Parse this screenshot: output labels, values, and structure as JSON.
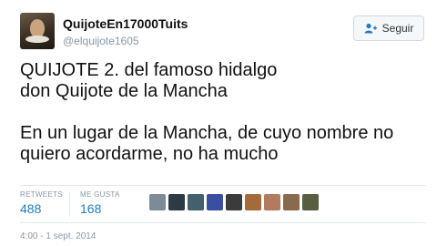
{
  "user": {
    "display_name": "QuijoteEn17000Tuits",
    "handle": "@elquijote1605"
  },
  "follow_button": {
    "label": "Seguir",
    "icon": "add-user-icon"
  },
  "tweet": {
    "lines_para1": [
      "QUIJOTE 2. del famoso hidalgo",
      "don Quijote de la Mancha"
    ],
    "lines_para2": [
      "En un lugar de la Mancha, de cuyo nombre no",
      "quiero acordarme, no ha mucho"
    ]
  },
  "stats": {
    "retweets_label": "RETWEETS",
    "retweets_count": "488",
    "likes_label": "ME GUSTA",
    "likes_count": "168"
  },
  "likers": [
    {
      "color": "#7d8b96"
    },
    {
      "color": "#2c3a44"
    },
    {
      "color": "#44606e"
    },
    {
      "color": "#3a4fa0"
    },
    {
      "color": "#3b3b3b"
    },
    {
      "color": "#a56a3c"
    },
    {
      "color": "#b27b5f"
    },
    {
      "color": "#8a6a4c"
    },
    {
      "color": "#5a5e40"
    }
  ],
  "timestamp": "4:00 - 1 sept. 2014",
  "colors": {
    "accent": "#1f7bbf",
    "muted": "#8899a6"
  }
}
